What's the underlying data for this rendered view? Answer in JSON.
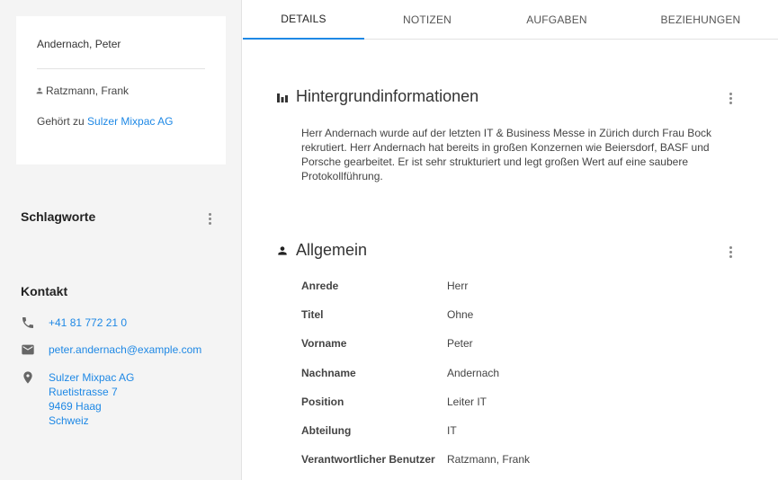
{
  "card": {
    "name": "Andernach, Peter",
    "owner": "Ratzmann, Frank",
    "company_prefix": "Gehört zu",
    "company_link": "Sulzer Mixpac AG"
  },
  "tags": {
    "title": "Schlagworte"
  },
  "contact": {
    "title": "Kontakt",
    "phone": "+41 81 772 21 0",
    "email": "peter.andernach@example.com",
    "address": [
      "Sulzer Mixpac AG",
      "Ruetistrasse 7",
      "9469 Haag",
      "Schweiz"
    ]
  },
  "tabs": [
    {
      "label": "DETAILS"
    },
    {
      "label": "NOTIZEN"
    },
    {
      "label": "AUFGABEN"
    },
    {
      "label": "BEZIEHUNGEN"
    }
  ],
  "background": {
    "title": "Hintergrundinformationen",
    "text": "Herr Andernach wurde auf der letzten IT & Business Messe in Zürich durch Frau Bock rekrutiert. Herr Andernach hat bereits in großen Konzernen wie Beiersdorf, BASF und Porsche gearbeitet. Er ist sehr strukturiert und legt großen Wert auf eine saubere Protokollführung."
  },
  "general": {
    "title": "Allgemein",
    "fields": [
      {
        "label": "Anrede",
        "value": "Herr"
      },
      {
        "label": "Titel",
        "value": "Ohne"
      },
      {
        "label": "Vorname",
        "value": "Peter"
      },
      {
        "label": "Nachname",
        "value": "Andernach"
      },
      {
        "label": "Position",
        "value": "Leiter IT"
      },
      {
        "label": "Abteilung",
        "value": "IT"
      },
      {
        "label": "Verantwortlicher Benutzer",
        "value": "Ratzmann, Frank"
      }
    ]
  },
  "colors": {
    "accent": "#1e88e5",
    "sidebar_bg": "#f4f4f4"
  },
  "icons": [
    "person-icon",
    "kebab-menu-icon",
    "phone-icon",
    "mail-icon",
    "location-pin-icon",
    "bar-chart-icon"
  ]
}
